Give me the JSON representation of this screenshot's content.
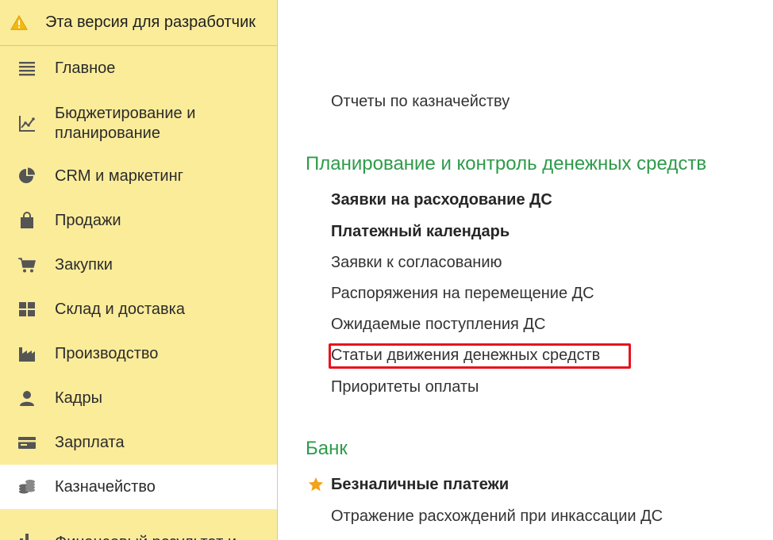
{
  "warning": {
    "icon": "warning-icon",
    "text": "Эта версия для разработчик"
  },
  "sidebar": {
    "items": [
      {
        "label": "Главное",
        "icon": "menu-lines-icon",
        "active": false
      },
      {
        "label": "Бюджетирование и\nпланирование",
        "icon": "budget-chart-icon",
        "active": false
      },
      {
        "label": "CRM и маркетинг",
        "icon": "pie-chart-icon",
        "active": false
      },
      {
        "label": "Продажи",
        "icon": "shopping-bag-icon",
        "active": false
      },
      {
        "label": "Закупки",
        "icon": "cart-icon",
        "active": false
      },
      {
        "label": "Склад и доставка",
        "icon": "warehouse-grid-icon",
        "active": false
      },
      {
        "label": "Производство",
        "icon": "factory-icon",
        "active": false
      },
      {
        "label": "Кадры",
        "icon": "person-icon",
        "active": false
      },
      {
        "label": "Зарплата",
        "icon": "wallet-icon",
        "active": false
      },
      {
        "label": "Казначейство",
        "icon": "coins-icon",
        "active": true
      },
      {
        "label": "Финансовый результат и",
        "icon": "finance-chart-icon",
        "active": false
      }
    ]
  },
  "main": {
    "treasury_reports": "Отчеты по казначейству",
    "planning_section": {
      "title": "Планирование и контроль денежных средств",
      "links": [
        {
          "label": "Заявки на расходование ДС",
          "bold": true
        },
        {
          "label": "Платежный календарь",
          "bold": true
        },
        {
          "label": "Заявки к согласованию",
          "bold": false
        },
        {
          "label": "Распоряжения на перемещение ДС",
          "bold": false
        },
        {
          "label": "Ожидаемые поступления ДС",
          "bold": false
        },
        {
          "label": "Статьи движения денежных средств",
          "bold": false,
          "highlighted": true
        },
        {
          "label": "Приоритеты оплаты",
          "bold": false
        }
      ]
    },
    "bank_section": {
      "title": "Банк",
      "links": [
        {
          "label": "Безналичные платежи",
          "bold": true,
          "favorite": true
        },
        {
          "label": "Отражение расхождений при инкассации ДС",
          "bold": false
        }
      ]
    }
  },
  "colors": {
    "sidebar_bg": "#fbec9a",
    "section_title": "#2e9b4a",
    "highlight": "#e8121e",
    "star": "#f2a21b"
  }
}
